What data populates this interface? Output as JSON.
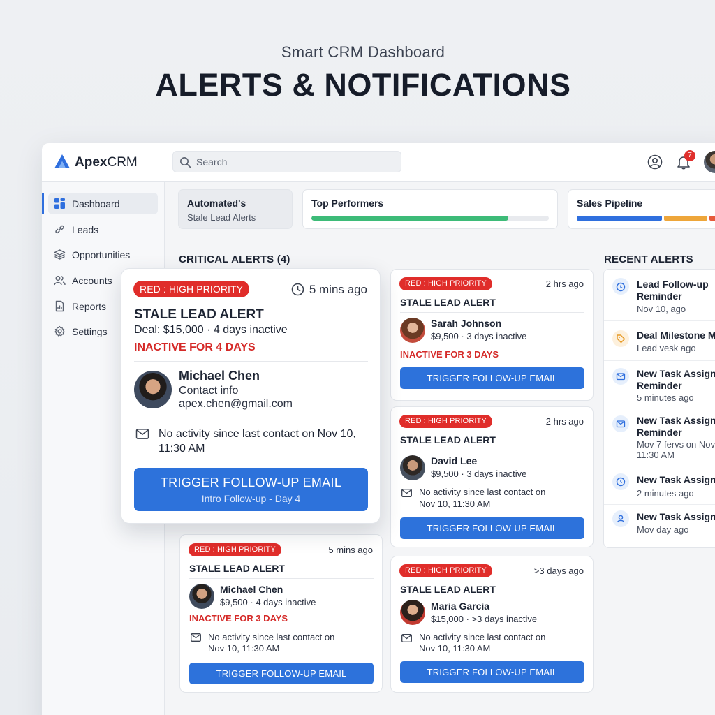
{
  "hero": {
    "subtitle": "Smart CRM Dashboard",
    "title": "ALERTS & NOTIFICATIONS"
  },
  "app": {
    "logo_prefix": "Apex",
    "logo_suffix": "CRM",
    "brand_color": "#2f6fde"
  },
  "search": {
    "placeholder": "Search",
    "value": ""
  },
  "topbar": {
    "notification_count": "7"
  },
  "sidebar": {
    "items": [
      {
        "label": "Dashboard",
        "icon": "grid-icon",
        "active": true
      },
      {
        "label": "Leads",
        "icon": "link-icon"
      },
      {
        "label": "Opportunities",
        "icon": "layers-icon"
      },
      {
        "label": "Accounts",
        "icon": "users-icon"
      },
      {
        "label": "Reports",
        "icon": "document-icon"
      },
      {
        "label": "Settings",
        "icon": "gear-icon"
      }
    ]
  },
  "chips": {
    "automated": {
      "title": "Automated's",
      "subtitle": "Stale Lead Alerts"
    },
    "top_performers": {
      "title": "Top Performers",
      "progress": 0.83
    },
    "sales_pipeline": {
      "title": "Sales Pipeline"
    }
  },
  "sections": {
    "critical": "CRITICAL ALERTS (4)",
    "recent": "RECENT ALERTS"
  },
  "focus_card": {
    "badge": "RED : HIGH PRIORITY",
    "time": "5 mins ago",
    "heading": "STALE LEAD ALERT",
    "deal": "Deal: $15,000 · 4 days inactive",
    "inactive": "INACTIVE FOR 4 DAYS",
    "name": "Michael Chen",
    "contact_label": "Contact info",
    "email": "apex.chen@gmail.com",
    "note": "No activity since last contact on Nov 10, 11:30 AM",
    "button": "TRIGGER FOLLOW-UP EMAIL",
    "button_sub": "Intro Follow-up - Day 4"
  },
  "cards": [
    {
      "badge": "RED : HIGH PRIORITY",
      "time": "2 hrs ago",
      "heading": "STALE LEAD ALERT",
      "name": "Sarah Johnson",
      "details": "$9,500 · 3 days inactive",
      "inactive": "INACTIVE FOR 3 DAYS",
      "button": "TRIGGER FOLLOW-UP EMAIL"
    },
    {
      "badge": "RED : HIGH PRIORITY",
      "time": "2 hrs ago",
      "heading": "STALE LEAD ALERT",
      "name": "David Lee",
      "details": "$9,500 · 3 days inactive",
      "note_line1": "No activity since last contact on",
      "note_line2": "Nov 10, 11:30 AM",
      "button": "TRIGGER FOLLOW-UP EMAIL"
    },
    {
      "badge": "RED : HIGH PRIORITY",
      "time": "5 mins ago",
      "heading": "STALE LEAD ALERT",
      "name": "Michael Chen",
      "details": "$9,500 · 4 days inactive",
      "inactive": "INACTIVE FOR 3 DAYS",
      "note_line1": "No activity since last contact on",
      "note_line2": "Nov 10, 11:30 AM",
      "button": "TRIGGER FOLLOW-UP EMAIL"
    },
    {
      "badge": "RED : HIGH PRIORITY",
      "time": ">3 days ago",
      "heading": "STALE LEAD ALERT",
      "name": "Maria Garcia",
      "details": "$15,000 · >3 days inactive",
      "note_line1": "No activity since last contact on",
      "note_line2": "Nov 10, 11:30 AM",
      "button": "TRIGGER FOLLOW-UP EMAIL"
    }
  ],
  "recent_alerts": [
    {
      "title_1": "Lead Follow-up",
      "title_2": "Reminder",
      "sub_1": "Nov 10, ago",
      "icon": "alarm-clock-icon"
    },
    {
      "title_1": "Deal Milestone M",
      "sub_1": "Lead vesk ago",
      "icon": "tag-icon"
    },
    {
      "title_1": "New Task Assign",
      "title_2": "Reminder",
      "sub_1": "5 minutes ago",
      "icon": "mail-icon"
    },
    {
      "title_1": "New Task Assign",
      "title_2": "Reminder",
      "sub_1": "Mov 7 fervs on Nov",
      "sub_2": "11:30 AM",
      "icon": "mail-icon"
    },
    {
      "title_1": "New Task Assign",
      "sub_1": "2 minutes ago",
      "icon": "clock-icon"
    },
    {
      "title_1": "New Task Assign",
      "sub_1": "Mov day ago",
      "icon": "user-icon"
    }
  ]
}
